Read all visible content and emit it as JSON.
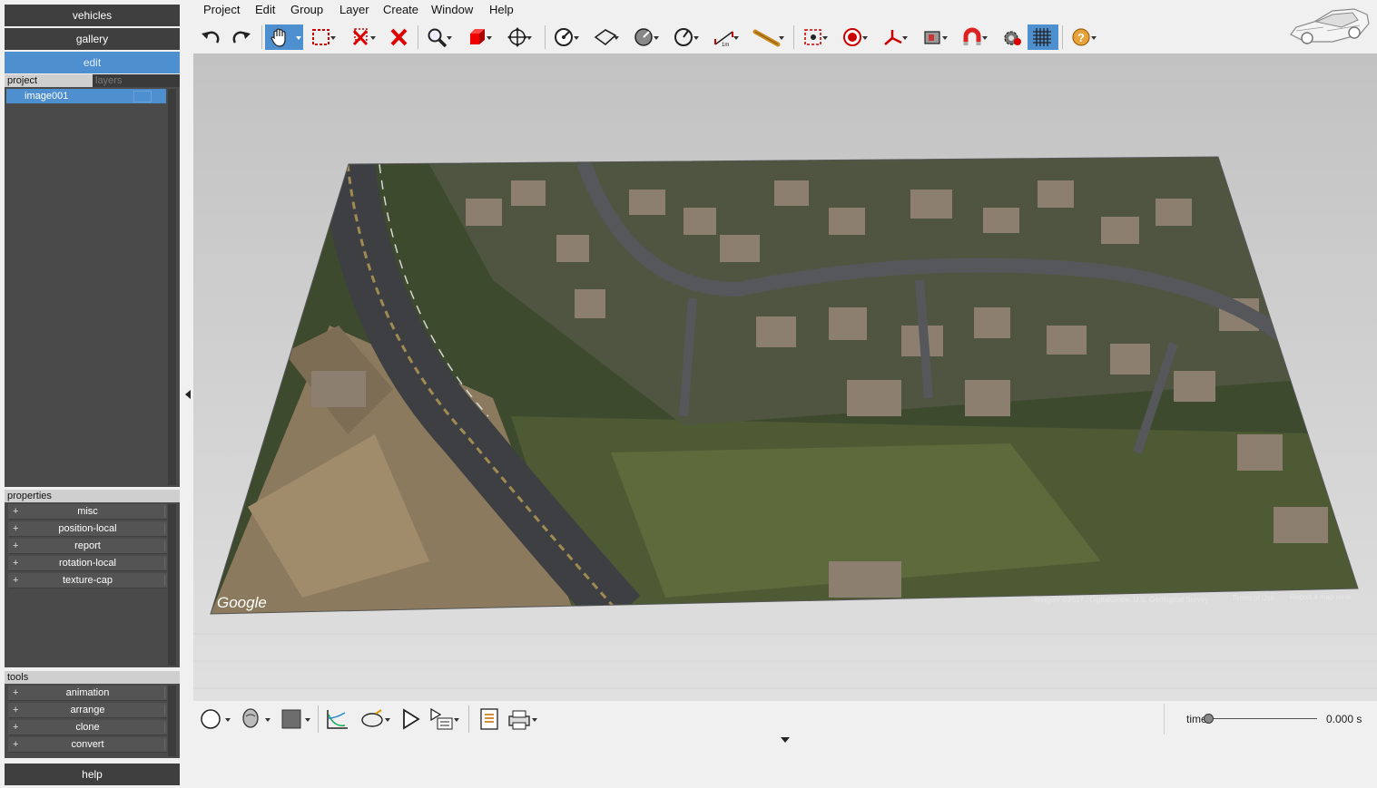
{
  "nav": {
    "vehicles": "vehicles",
    "gallery": "gallery",
    "edit": "edit",
    "help": "help"
  },
  "panel_tabs": {
    "project": "project",
    "layers": "layers"
  },
  "tree": {
    "items": [
      "image001"
    ]
  },
  "properties": {
    "title": "properties",
    "items": [
      "misc",
      "position-local",
      "report",
      "rotation-local",
      "texture-cap"
    ]
  },
  "tools": {
    "title": "tools",
    "items": [
      "animation",
      "arrange",
      "clone",
      "convert"
    ]
  },
  "expand_symbol": "+",
  "menu": [
    "Project",
    "Edit",
    "Group",
    "Layer",
    "Create",
    "Window",
    "Help"
  ],
  "toolbar": {
    "tools": [
      "undo-icon",
      "redo-icon",
      "pan-hand-icon",
      "select-box-icon",
      "delete-multi-icon",
      "delete-icon",
      "zoom-icon",
      "cube-icon",
      "move-icon",
      "measure-angle-icon",
      "plane-icon",
      "rotate-icon",
      "radius-icon",
      "scale-ruler-icon",
      "measure-tape-icon",
      "point-target-icon",
      "record-icon",
      "axes-icon",
      "camera-icon",
      "magnet-icon",
      "settings-record-icon",
      "grid-icon",
      "help-icon"
    ],
    "selected": "pan-hand-icon"
  },
  "viewport": {
    "map_watermark": "Google",
    "map_attribution": "Imagery ©2017 , DigitalGlobe, U.S. Geological Survey",
    "map_terms": "Terms of Use",
    "map_report": "Report a map error"
  },
  "bottombar": {
    "time_label": "time",
    "time_value": "0.000 s",
    "time_position": 0.0
  },
  "colors": {
    "accent": "#4d8fcf",
    "panel_dark": "#3f3f3f",
    "panel_bg": "#4a4a4a"
  }
}
